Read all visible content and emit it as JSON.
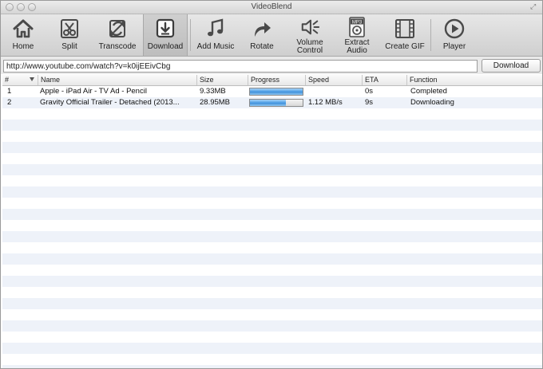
{
  "window": {
    "title": "VideoBlend"
  },
  "toolbar": {
    "items": [
      {
        "label": "Home",
        "icon": "home-icon"
      },
      {
        "label": "Split",
        "icon": "scissors-icon"
      },
      {
        "label": "Transcode",
        "icon": "transcode-icon"
      },
      {
        "label": "Download",
        "icon": "download-icon",
        "active": true
      },
      {
        "label": "Add Music",
        "icon": "music-note-icon"
      },
      {
        "label": "Rotate",
        "icon": "rotate-arrow-icon"
      },
      {
        "label_line1": "Volume",
        "label_line2": "Control",
        "icon": "speaker-icon"
      },
      {
        "label_line1": "Extract",
        "label_line2": "Audio",
        "icon": "mp3-file-icon",
        "icon_text": "MP3"
      },
      {
        "label": "Create GIF",
        "icon": "film-strip-icon"
      },
      {
        "label": "Player",
        "icon": "play-circle-icon"
      }
    ]
  },
  "url_bar": {
    "value": "http://www.youtube.com/watch?v=k0ijEEivCbg",
    "button_label": "Download"
  },
  "table": {
    "columns": [
      "#",
      "Name",
      "Size",
      "Progress",
      "Speed",
      "ETA",
      "Function"
    ],
    "rows": [
      {
        "index": "1",
        "name": "Apple - iPad Air - TV Ad - Pencil",
        "size": "9.33MB",
        "progress": 1.0,
        "speed": "",
        "eta": "0s",
        "function": "Completed"
      },
      {
        "index": "2",
        "name": "Gravity Official Trailer - Detached (2013...",
        "size": "28.95MB",
        "progress": 0.68,
        "speed": "1.12 MB/s",
        "eta": "9s",
        "function": "Downloading"
      }
    ]
  },
  "colors": {
    "progress_fill": "#4c9ee6",
    "row_stripe": "#eef2f9",
    "toolbar_bg": "#dcdcdc"
  }
}
